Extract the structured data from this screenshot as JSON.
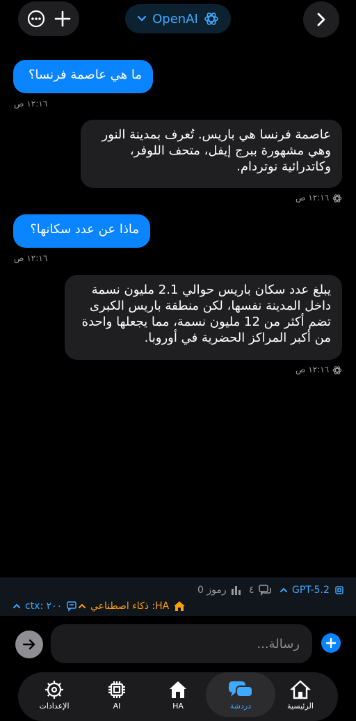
{
  "header": {
    "provider_label": "OpenAI",
    "icons": [
      "more-icon",
      "plus-icon",
      "chevron-down-icon",
      "openai-logo-icon",
      "chevron-right-icon"
    ]
  },
  "messages": [
    {
      "role": "user",
      "text": "ما هي عاصمة فرنسا؟",
      "time": "١٢:١٦ ص"
    },
    {
      "role": "assistant",
      "text": "عاصمة فرنسا هي باريس. تُعرف بمدينة النور وهي مشهورة ببرج إيفل، متحف اللوفر، وكاتدرائية نوتردام.",
      "time": "١٢:١٦ ص"
    },
    {
      "role": "user",
      "text": "ماذا عن عدد سكانها؟",
      "time": "١٢:١٦ ص"
    },
    {
      "role": "assistant",
      "text": "يبلغ عدد سكان باريس حوالي 2.1 مليون نسمة داخل المدينة نفسها، لكن منطقة باريس الكبرى تضم أكثر من 12 مليون نسمة، مما يجعلها واحدة من أكبر المراكز الحضرية في أوروبا.",
      "time": "١٢:١٦ ص"
    }
  ],
  "status": {
    "model": "GPT-5.2",
    "messages_count": "٤",
    "tokens_label": "رموز 0",
    "ha_label": "ذكاء اصطناعي :HA",
    "ctx_label": "ctx: ٢٠٠"
  },
  "composer": {
    "placeholder": "رسالة..."
  },
  "tabs": [
    {
      "label": "الإعدادات",
      "icon": "gear-icon"
    },
    {
      "label": "AI",
      "icon": "chip-icon"
    },
    {
      "label": "HA",
      "icon": "home-icon"
    },
    {
      "label": "دردشة",
      "icon": "chat-bubbles-icon",
      "active": true
    },
    {
      "label": "الرئيسية",
      "icon": "home-icon"
    }
  ],
  "colors": {
    "accent": "#0a84ff",
    "link_blue": "#3fa8ff",
    "orange": "#ff9f0a",
    "background": "#000000",
    "bubble_assistant": "#1f1f22"
  }
}
